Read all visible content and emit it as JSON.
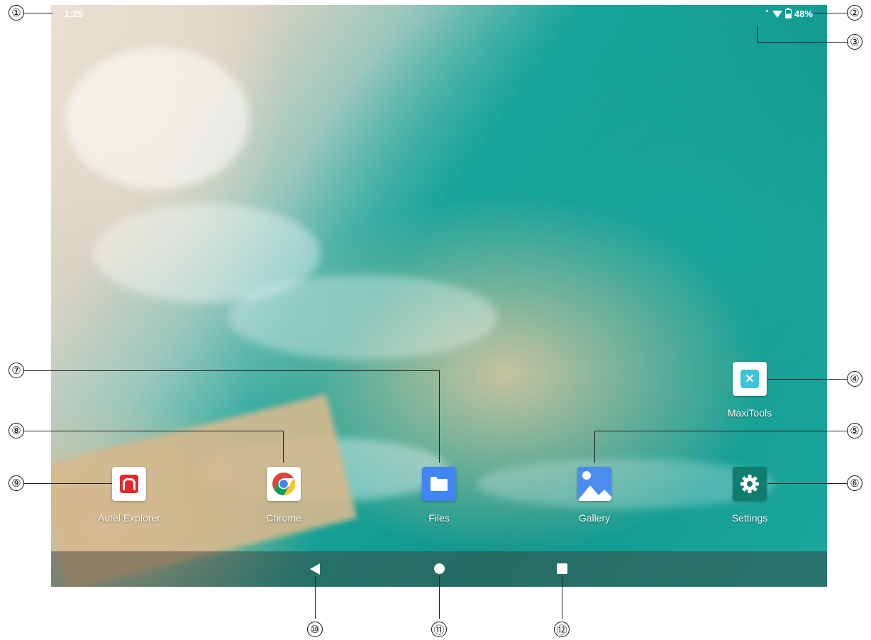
{
  "status_bar": {
    "time": "1:25",
    "battery": "48%"
  },
  "apps": {
    "maxitools": "MaxiTools",
    "autel": "Autel Explorer",
    "chrome": "Chrome",
    "files": "Files",
    "gallery": "Gallery",
    "settings": "Settings"
  },
  "callouts": [
    "①",
    "②",
    "③",
    "④",
    "⑤",
    "⑥",
    "⑦",
    "⑧",
    "⑨",
    "⑩",
    "⑪",
    "⑫"
  ],
  "colors": {
    "autel_red": "#e8272b",
    "files_blue": "#4285f4",
    "settings_teal": "#0f7e6f"
  }
}
